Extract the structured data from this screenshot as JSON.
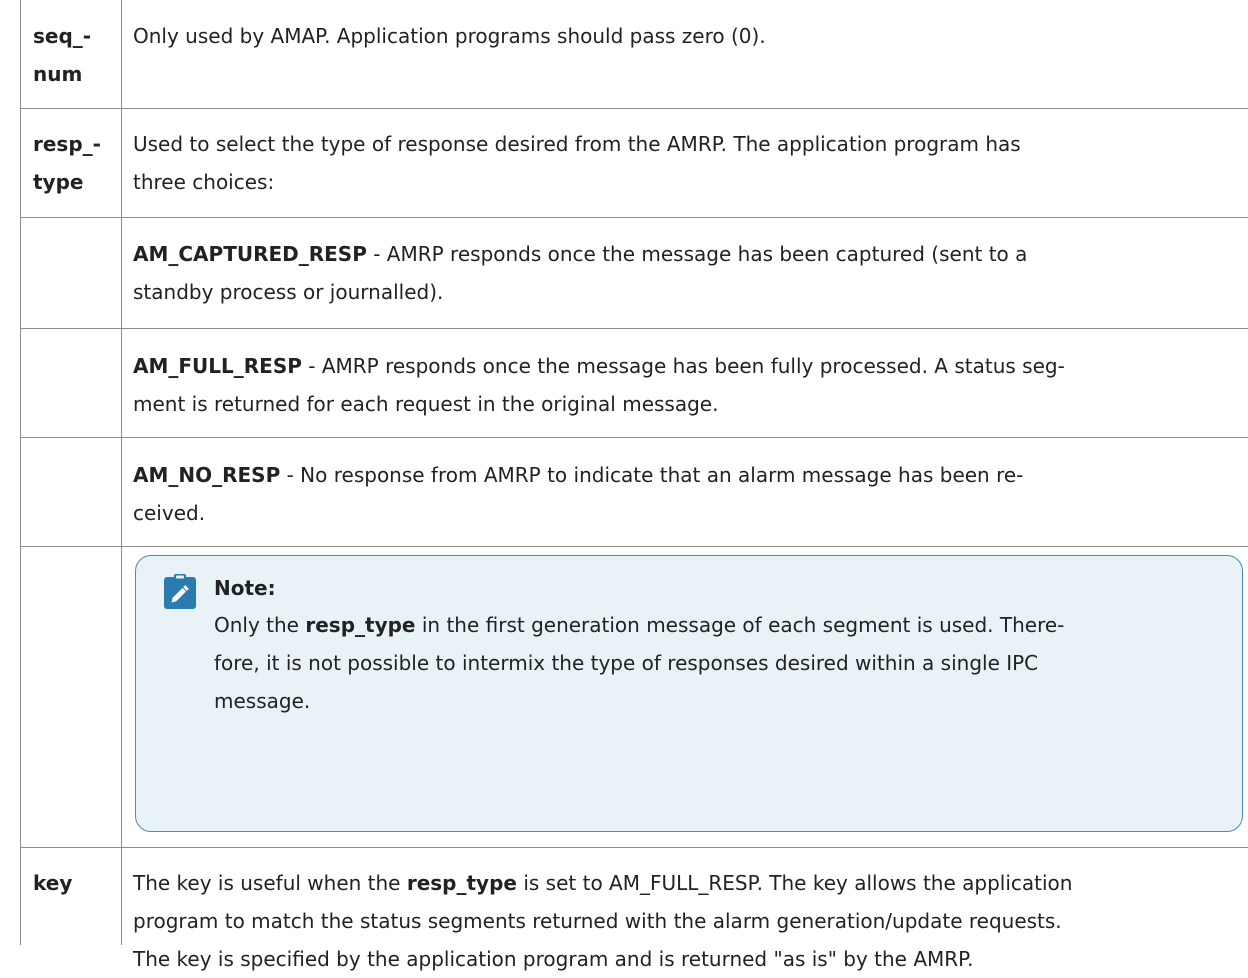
{
  "rows": [
    {
      "name_line1": "seq_-",
      "name_line2": "num",
      "desc": "Only used by AMAP. Application programs should pass zero (0)."
    },
    {
      "name_line1": "resp_-",
      "name_line2": "type",
      "desc_line1": "Used to select the type of response desired from the AMRP. The application program has",
      "desc_line2": "three choices:"
    },
    {
      "term": "AM_CAPTURED_RESP",
      "desc_line1": " - AMRP responds once the message has been captured (sent to a",
      "desc_line2": "standby process or journalled)."
    },
    {
      "term": "AM_FULL_RESP",
      "desc_line1": " - AMRP responds once the message has been fully processed. A status seg-",
      "desc_line2": "ment is returned for each request in the original message."
    },
    {
      "term": "AM_NO_RESP",
      "desc_line1": " - No response from AMRP to indicate that an alarm message has been re-",
      "desc_line2": "ceived."
    },
    {
      "name": "key",
      "line1_pre": "The key is useful when the ",
      "line1_term": "resp_type",
      "line1_post": " is set to AM_FULL_RESP. The key allows the application",
      "line2": "program to match the status segments returned with the alarm generation/update requests.",
      "line3": "The key is specified by the application program and is returned \"as is\" by the AMRP."
    }
  ],
  "note": {
    "icon": "pencil-icon",
    "title": "Note:",
    "line1_pre": "Only the ",
    "line1_term": "resp_type",
    "line1_post": " in the first generation message of each segment is used. There-",
    "line2": "fore, it is not possible to intermix the type of responses desired within a single IPC",
    "line3": "message."
  },
  "colors": {
    "note_bg": "#e9f2f6",
    "note_border": "#4a8cb0",
    "icon": "#2a7bb0",
    "rule": "#8c8c8c"
  }
}
